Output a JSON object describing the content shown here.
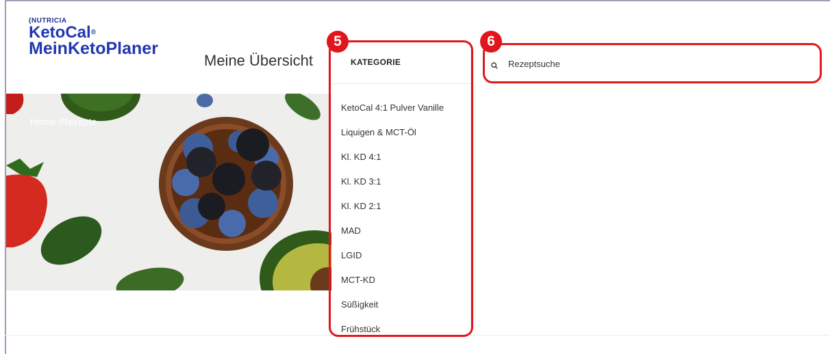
{
  "header": {
    "brand_small": "NUTRICIA",
    "brand_line1": "KetoCal",
    "brand_line1_mark": "®",
    "brand_line2": "MeinKetoPlaner",
    "nav_title": "Meine Übersicht"
  },
  "breadcrumb": "Home /Rezepte",
  "category": {
    "title": "KATEGORIE",
    "items": [
      "KetoCal 4:1 Pulver Vanille",
      "Liquigen & MCT-Öl",
      "Kl. KD 4:1",
      "Kl. KD 3:1",
      "Kl. KD 2:1",
      "MAD",
      "LGID",
      "MCT-KD",
      "Süßigkeit",
      "Frühstück"
    ]
  },
  "search": {
    "placeholder": "Rezeptsuche"
  },
  "annotations": {
    "badge_5": "5",
    "badge_6": "6",
    "color": "#e0161c"
  },
  "colors": {
    "brand": "#2237b0"
  }
}
